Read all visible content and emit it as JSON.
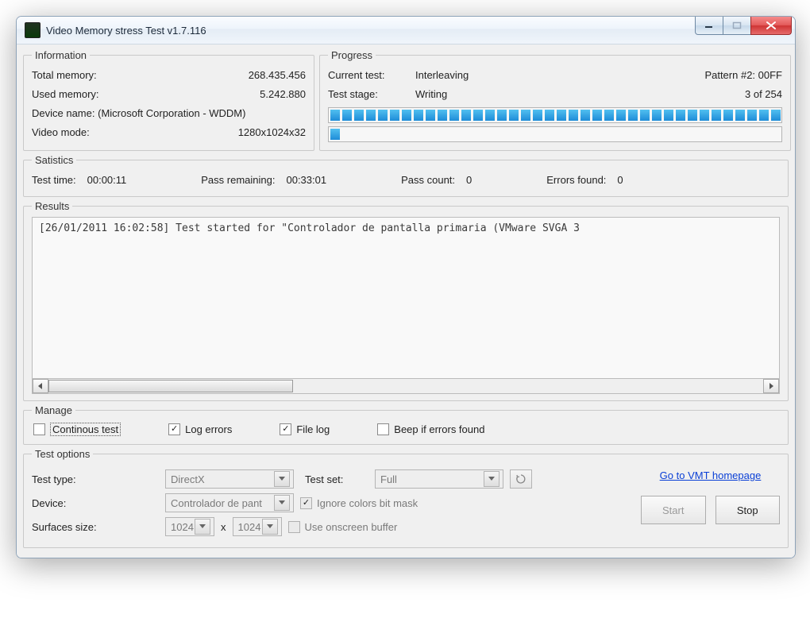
{
  "window": {
    "title": "Video Memory stress Test v1.7.116"
  },
  "information": {
    "legend": "Information",
    "total_label": "Total memory:",
    "total_value": "268.435.456",
    "used_label": "Used memory:",
    "used_value": "5.242.880",
    "device_label": "Device name:",
    "device_value": "(Microsoft Corporation - WDDM)",
    "mode_label": "Video mode:",
    "mode_value": "1280x1024x32"
  },
  "progress": {
    "legend": "Progress",
    "current_label": "Current test:",
    "current_value": "Interleaving",
    "pattern": "Pattern #2: 00FF",
    "stage_label": "Test stage:",
    "stage_value": "Writing",
    "stage_count": "3 of 254"
  },
  "statistics": {
    "legend": "Satistics",
    "time_label": "Test time:",
    "time_value": "00:00:11",
    "remain_label": "Pass remaining:",
    "remain_value": "00:33:01",
    "passcount_label": "Pass count:",
    "passcount_value": "0",
    "errors_label": "Errors found:",
    "errors_value": "0"
  },
  "results": {
    "legend": "Results",
    "log_line": "[26/01/2011 16:02:58] Test started for \"Controlador de pantalla primaria (VMware SVGA 3"
  },
  "manage": {
    "legend": "Manage",
    "continuous": "Continous test",
    "log_errors": "Log errors",
    "file_log": "File log",
    "beep": "Beep if errors found"
  },
  "options": {
    "legend": "Test options",
    "testtype_label": "Test type:",
    "testtype_value": "DirectX",
    "testset_label": "Test set:",
    "testset_value": "Full",
    "device_label": "Device:",
    "device_value": "Controlador de pant",
    "ignore_mask": "Ignore colors bit mask",
    "surfaces_label": "Surfaces size:",
    "surf_x": "1024",
    "surf_y": "1024",
    "surf_sep": "x",
    "onscreen": "Use onscreen buffer"
  },
  "buttons": {
    "link": "Go to VMT homepage",
    "start": "Start",
    "stop": "Stop"
  }
}
